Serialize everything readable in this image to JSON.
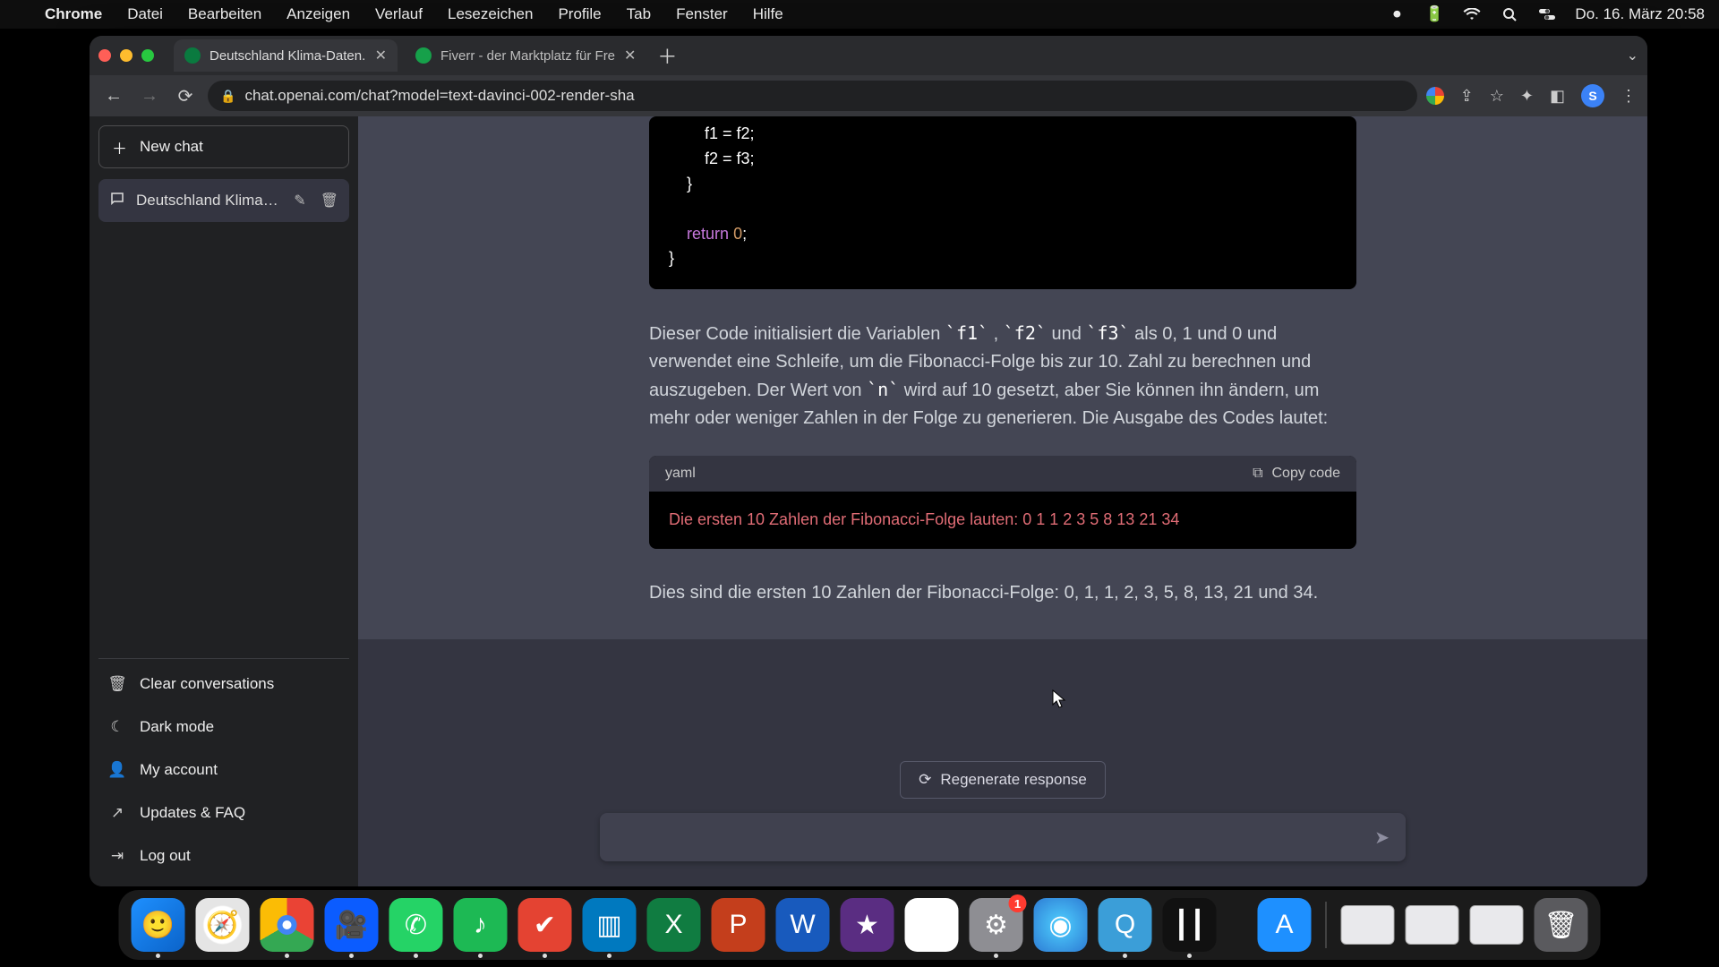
{
  "menubar": {
    "app_name": "Chrome",
    "items": [
      "Datei",
      "Bearbeiten",
      "Anzeigen",
      "Verlauf",
      "Lesezeichen",
      "Profile",
      "Tab",
      "Fenster",
      "Hilfe"
    ],
    "clock": "Do. 16. März  20:58"
  },
  "tabs": {
    "active": {
      "title": "Deutschland Klima-Daten."
    },
    "inactive": {
      "title": "Fiverr - der Marktplatz für Fre"
    }
  },
  "omnibox": {
    "url": "chat.openai.com/chat?model=text-davinci-002-render-sha"
  },
  "toolbar": {
    "avatar_initial": "S"
  },
  "sidebar": {
    "new_chat": "New chat",
    "conversation": "Deutschland Klima-Da",
    "footer": {
      "clear": "Clear conversations",
      "dark": "Dark mode",
      "account": "My account",
      "updates": "Updates & FAQ",
      "logout": "Log out"
    }
  },
  "chat": {
    "code1_lines": "        f1 = f2;\n        f2 = f3;\n    }\n\n    return 0;\n}",
    "para1_a": "Dieser Code initialisiert die Variablen ",
    "para1_f1": "`f1`",
    "para1_b": ", ",
    "para1_f2": "`f2`",
    "para1_c": " und ",
    "para1_f3": "`f3`",
    "para1_d": " als 0, 1 und 0 und verwendet eine Schleife, um die Fibonacci-Folge bis zur 10. Zahl zu berechnen und auszugeben. Der Wert von ",
    "para1_n": "`n`",
    "para1_e": " wird auf 10 gesetzt, aber Sie können ihn ändern, um mehr oder weniger Zahlen in der Folge zu generieren. Die Ausgabe des Codes lautet:",
    "code2_lang": "yaml",
    "copy_label": "Copy code",
    "code2_body": "Die ersten 10 Zahlen der Fibonacci-Folge lauten: 0 1 1 2 3 5 8 13 21 34",
    "para2": "Dies sind die ersten 10 Zahlen der Fibonacci-Folge: 0, 1, 1, 2, 3, 5, 8, 13, 21 und 34."
  },
  "composer": {
    "regenerate": "Regenerate response",
    "placeholder": ""
  },
  "dock": {
    "badge_settings": "1"
  }
}
